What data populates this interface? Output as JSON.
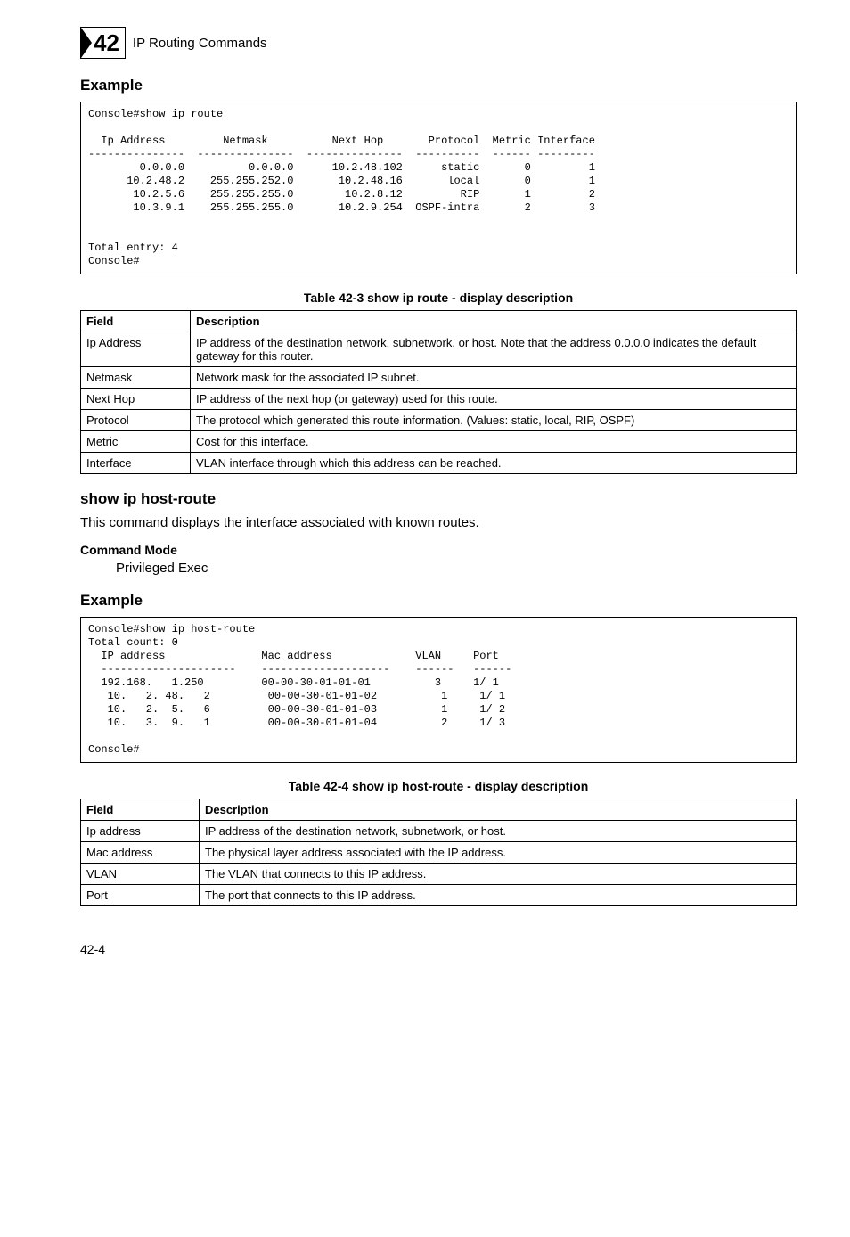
{
  "header": {
    "chapter_number": "42",
    "chapter_title": "IP Routing Commands"
  },
  "example1": {
    "heading": "Example",
    "console": "Console#show ip route\n\n  Ip Address         Netmask          Next Hop       Protocol  Metric Interface\n---------------  ---------------  ---------------  ----------  ------ ---------\n        0.0.0.0          0.0.0.0      10.2.48.102      static       0         1\n      10.2.48.2    255.255.252.0       10.2.48.16       local       0         1\n       10.2.5.6    255.255.255.0        10.2.8.12         RIP       1         2\n       10.3.9.1    255.255.255.0       10.2.9.254  OSPF-intra       2         3\n\n\nTotal entry: 4\nConsole#"
  },
  "table1": {
    "caption": "Table 42-3   show ip route - display description",
    "hField": "Field",
    "hDesc": "Description",
    "rows": [
      {
        "f": "Ip Address",
        "d": "IP address of the destination network, subnetwork, or host. Note that the address 0.0.0.0 indicates the default gateway for this router."
      },
      {
        "f": "Netmask",
        "d": "Network mask for the associated IP subnet."
      },
      {
        "f": "Next Hop",
        "d": "IP address of the next hop (or gateway) used for this route."
      },
      {
        "f": "Protocol",
        "d": "The protocol which generated this route information. (Values: static, local, RIP, OSPF)"
      },
      {
        "f": "Metric",
        "d": "Cost for this interface."
      },
      {
        "f": "Interface",
        "d": "VLAN interface through which this address can be reached."
      }
    ]
  },
  "section2": {
    "heading": "show ip host-route",
    "desc": "This command displays the interface associated with known routes.",
    "cmdmode_label": "Command Mode",
    "cmdmode_value": "Privileged Exec"
  },
  "example2": {
    "heading": "Example",
    "console": "Console#show ip host-route\nTotal count: 0\n  IP address               Mac address             VLAN     Port\n  ---------------------    --------------------    ------   ------\n  192.168.   1.250         00-00-30-01-01-01          3     1/ 1\n   10.   2. 48.   2         00-00-30-01-01-02          1     1/ 1\n   10.   2.  5.   6         00-00-30-01-01-03          1     1/ 2\n   10.   3.  9.   1         00-00-30-01-01-04          2     1/ 3\n\nConsole#"
  },
  "table2": {
    "caption": "Table 42-4   show ip host-route - display description",
    "hField": "Field",
    "hDesc": "Description",
    "rows": [
      {
        "f": "Ip address",
        "d": "IP address of the destination network, subnetwork, or host."
      },
      {
        "f": "Mac address",
        "d": "The physical layer address associated with the IP address."
      },
      {
        "f": "VLAN",
        "d": "The VLAN that connects to this IP address."
      },
      {
        "f": "Port",
        "d": "The port that connects to this IP address."
      }
    ]
  },
  "footer": {
    "page": "42-4"
  },
  "chart_data": [
    {
      "type": "table",
      "title": "show ip route",
      "columns": [
        "Ip Address",
        "Netmask",
        "Next Hop",
        "Protocol",
        "Metric",
        "Interface"
      ],
      "rows": [
        [
          "0.0.0.0",
          "0.0.0.0",
          "10.2.48.102",
          "static",
          0,
          1
        ],
        [
          "10.2.48.2",
          "255.255.252.0",
          "10.2.48.16",
          "local",
          0,
          1
        ],
        [
          "10.2.5.6",
          "255.255.255.0",
          "10.2.8.12",
          "RIP",
          1,
          2
        ],
        [
          "10.3.9.1",
          "255.255.255.0",
          "10.2.9.254",
          "OSPF-intra",
          2,
          3
        ]
      ],
      "total_entry": 4
    },
    {
      "type": "table",
      "title": "show ip host-route",
      "total_count": 0,
      "columns": [
        "IP address",
        "Mac address",
        "VLAN",
        "Port"
      ],
      "rows": [
        [
          "192.168.1.250",
          "00-00-30-01-01-01",
          3,
          "1/ 1"
        ],
        [
          "10.2.48.2",
          "00-00-30-01-01-02",
          1,
          "1/ 1"
        ],
        [
          "10.2.5.6",
          "00-00-30-01-01-03",
          1,
          "1/ 2"
        ],
        [
          "10.3.9.1",
          "00-00-30-01-01-04",
          2,
          "1/ 3"
        ]
      ]
    }
  ]
}
